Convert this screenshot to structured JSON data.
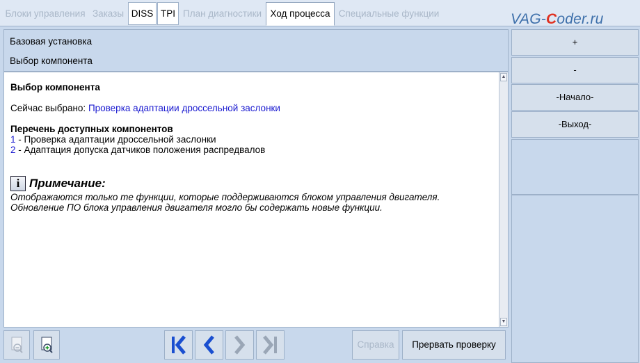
{
  "tabs": [
    {
      "label": "Блоки управления",
      "state": "disabled"
    },
    {
      "label": "Заказы",
      "state": "disabled"
    },
    {
      "label": "DISS",
      "state": "enabled"
    },
    {
      "label": "TPI",
      "state": "enabled"
    },
    {
      "label": "План диагностики",
      "state": "disabled"
    },
    {
      "label": "Ход процесса",
      "state": "active"
    },
    {
      "label": "Специальные функции",
      "state": "disabled"
    }
  ],
  "watermark": {
    "before": "VAG-",
    "highlight": "C",
    "after": "oder.ru"
  },
  "header": {
    "line1": "Базовая установка",
    "line2": "Выбор компонента"
  },
  "content": {
    "title": "Выбор компонента",
    "selected_label": "Сейчас выбрано: ",
    "selected_value": "Проверка адаптации дроссельной заслонки",
    "list_title": "Перечень доступных компонентов",
    "items": [
      {
        "num": "1",
        "text": " - Проверка адаптации дроссельной заслонки"
      },
      {
        "num": "2",
        "text": " - Адаптация допуска датчиков положения распредвалов"
      }
    ],
    "note_title": "Примечание:",
    "note_line1": "Отображаются только те функции, которые поддерживаются блоком управления двигателя.",
    "note_line2": "Обновление ПО блока управления двигателя могло бы содержать новые функции."
  },
  "right_panel": {
    "plus": "+",
    "minus": "-",
    "start": "-Начало-",
    "exit": "-Выход-"
  },
  "toolbar": {
    "help": "Справка",
    "abort": "Прервать проверку"
  },
  "colors": {
    "accent_blue": "#1a4fd0",
    "link_blue": "#1a1ad0",
    "panel_bg": "#c8d8ec"
  }
}
